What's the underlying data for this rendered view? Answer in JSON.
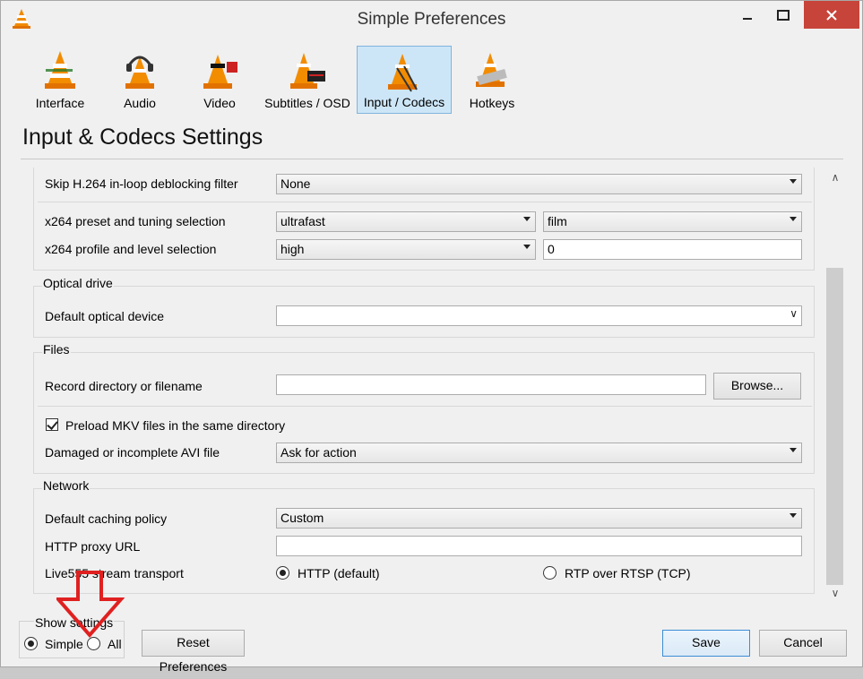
{
  "window": {
    "title": "Simple Preferences"
  },
  "toolbar": {
    "items": [
      {
        "label": "Interface"
      },
      {
        "label": "Audio"
      },
      {
        "label": "Video"
      },
      {
        "label": "Subtitles / OSD"
      },
      {
        "label": "Input / Codecs"
      },
      {
        "label": "Hotkeys"
      }
    ],
    "active": "Input / Codecs"
  },
  "section_title": "Input & Codecs Settings",
  "codecs": {
    "skip_h264_label": "Skip H.264 in-loop deblocking filter",
    "skip_h264_value": "None",
    "x264_preset_label": "x264 preset and tuning selection",
    "x264_preset_value": "ultrafast",
    "x264_tuning_value": "film",
    "x264_profile_label": "x264 profile and level selection",
    "x264_profile_value": "high",
    "x264_level_value": "0"
  },
  "optical": {
    "group_title": "Optical drive",
    "device_label": "Default optical device",
    "device_value": ""
  },
  "files": {
    "group_title": "Files",
    "record_label": "Record directory or filename",
    "record_value": "",
    "browse_label": "Browse...",
    "preload_label": "Preload MKV files in the same directory",
    "avi_label": "Damaged or incomplete AVI file",
    "avi_value": "Ask for action"
  },
  "network": {
    "group_title": "Network",
    "caching_label": "Default caching policy",
    "caching_value": "Custom",
    "proxy_label": "HTTP proxy URL",
    "proxy_value": "",
    "transport_label": "Live555 stream transport",
    "transport_http": "HTTP (default)",
    "transport_rtp": "RTP over RTSP (TCP)"
  },
  "bottom": {
    "show_settings_label": "Show settings",
    "simple_label": "Simple",
    "all_label": "All",
    "reset_label": "Reset Preferences",
    "save_label": "Save",
    "cancel_label": "Cancel"
  },
  "colors": {
    "annotation_arrow": "#e02020",
    "active_tab_bg": "#cde6f7",
    "close_button": "#c7443a"
  }
}
